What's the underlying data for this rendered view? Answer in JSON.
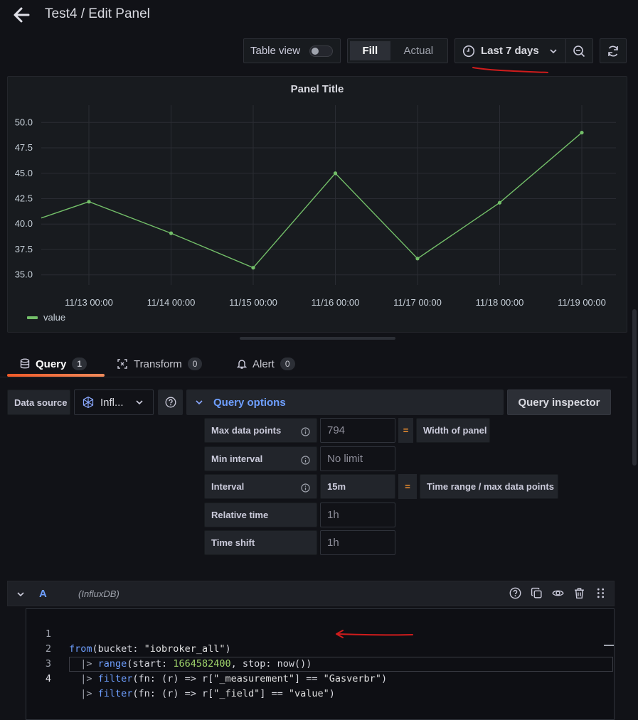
{
  "header": {
    "title": "Test4 / Edit Panel"
  },
  "toolbar": {
    "table_view_label": "Table view",
    "table_view_enabled": false,
    "fill_label": "Fill",
    "actual_label": "Actual",
    "time_range_label": "Last 7 days"
  },
  "panel": {
    "title": "Panel Title"
  },
  "chart_data": {
    "type": "line",
    "title": "Panel Title",
    "x": [
      "11/12 12:00",
      "11/13 00:00",
      "11/14 00:00",
      "11/15 00:00",
      "11/16 00:00",
      "11/17 00:00",
      "11/18 00:00",
      "11/19 00:00"
    ],
    "x_ticks": [
      "11/13 00:00",
      "11/14 00:00",
      "11/15 00:00",
      "11/16 00:00",
      "11/17 00:00",
      "11/18 00:00",
      "11/19 00:00"
    ],
    "y_ticks": [
      "35.0",
      "37.5",
      "40.0",
      "42.5",
      "45.0",
      "47.5",
      "50.0"
    ],
    "series": [
      {
        "name": "value",
        "values": [
          40.6,
          42.2,
          39.1,
          35.7,
          45.0,
          36.6,
          42.1,
          49.0
        ],
        "color": "#73bf69"
      }
    ],
    "ylim": [
      34,
      51
    ],
    "grid": true,
    "legend": "bottom-left"
  },
  "tabs": [
    {
      "label": "Query",
      "count": "1"
    },
    {
      "label": "Transform",
      "count": "0"
    },
    {
      "label": "Alert",
      "count": "0"
    }
  ],
  "datasource": {
    "label": "Data source",
    "value": "Infl..."
  },
  "query_options": {
    "title": "Query options",
    "inspector_label": "Query inspector",
    "rows": [
      {
        "label": "Max data points",
        "value": "794",
        "eq": "=",
        "note": "Width of panel"
      },
      {
        "label": "Min interval",
        "value": "No limit"
      },
      {
        "label": "Interval",
        "value": "15m",
        "eq": "=",
        "note": "Time range / max data points"
      },
      {
        "label": "Relative time",
        "value": "1h"
      },
      {
        "label": "Time shift",
        "value": "1h"
      }
    ]
  },
  "query_editor": {
    "letter": "A",
    "datasource": "(InfluxDB)",
    "lines": [
      {
        "num": "1",
        "text": "from(bucket: \"iobroker_all\")"
      },
      {
        "num": "2",
        "text": "  |> range(start: 1664582400, stop: now())"
      },
      {
        "num": "3",
        "text": "  |> filter(fn: (r) => r[\"_measurement\"] == \"Gasverbr\")"
      },
      {
        "num": "4",
        "text": "  |> filter(fn: (r) => r[\"_field\"] == \"value\")"
      }
    ]
  },
  "colors": {
    "accent": "#f05a28",
    "link": "#6e9fff",
    "series": "#73bf69",
    "annotation": "#d01c1c"
  }
}
